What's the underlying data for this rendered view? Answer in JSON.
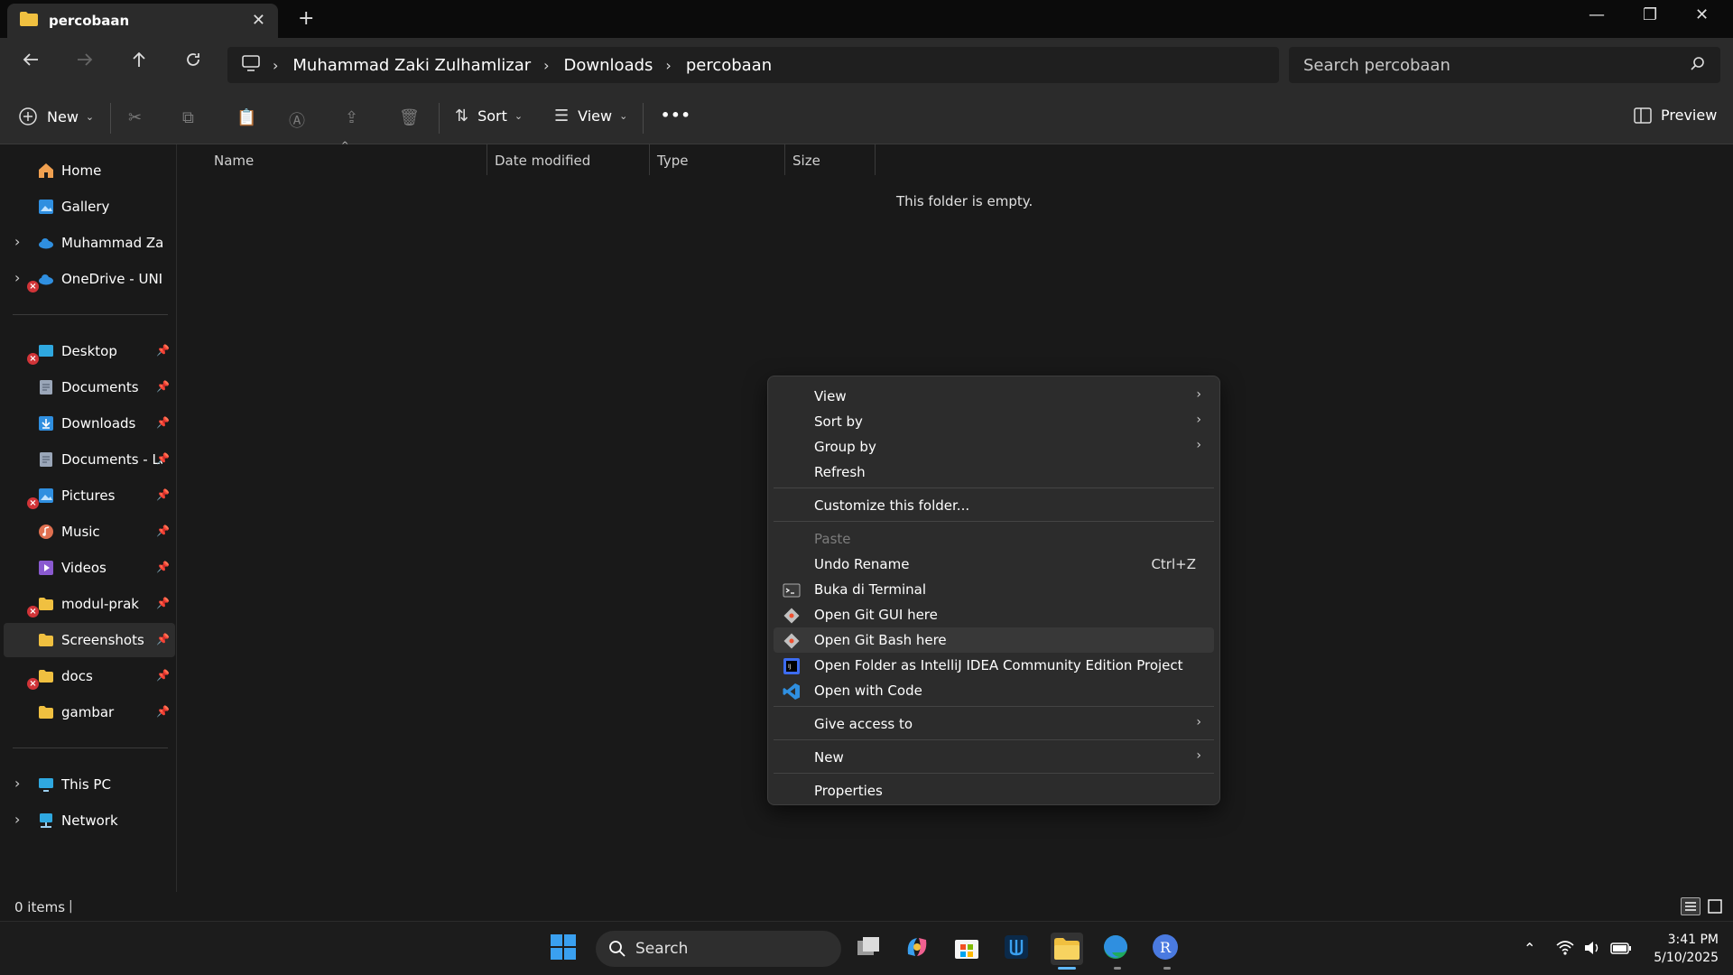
{
  "tab": {
    "title": "percobaan",
    "close": "✕",
    "new": "+"
  },
  "window": {
    "minimize": "—",
    "maximize": "❐",
    "close": "✕"
  },
  "nav": {
    "breadcrumb": [
      "Muhammad Zaki Zulhamlizar",
      "Downloads",
      "percobaan"
    ],
    "search_placeholder": "Search percobaan"
  },
  "commandbar": {
    "new_label": "New",
    "sort_label": "Sort",
    "view_label": "View",
    "more_label": "•••",
    "preview_label": "Preview"
  },
  "sidebar": {
    "top": [
      {
        "label": "Home",
        "icon": "home-icon",
        "color": "#f0a050"
      },
      {
        "label": "Gallery",
        "icon": "gallery-icon",
        "color": "#2f8fe0"
      },
      {
        "label": "Muhammad Zaki -",
        "icon": "onedrive-icon",
        "color": "#2f8fe0"
      },
      {
        "label": "OneDrive - UNIVER",
        "icon": "onedrive-icon",
        "color": "#2f8fe0"
      }
    ],
    "pinned": [
      {
        "label": "Desktop",
        "icon": "desktop-icon",
        "color": "#2fa8e0",
        "error": true
      },
      {
        "label": "Documents",
        "icon": "documents-icon",
        "color": "#9aa6b8",
        "error": false
      },
      {
        "label": "Downloads",
        "icon": "downloads-icon",
        "color": "#2f8fe0",
        "error": false
      },
      {
        "label": "Documents - Lap",
        "icon": "documents-icon",
        "color": "#9aa6b8",
        "error": false
      },
      {
        "label": "Pictures",
        "icon": "pictures-icon",
        "color": "#2f8fe0",
        "error": true
      },
      {
        "label": "Music",
        "icon": "music-icon",
        "color": "#e07050",
        "error": false
      },
      {
        "label": "Videos",
        "icon": "videos-icon",
        "color": "#8a5ad0",
        "error": false
      },
      {
        "label": "modul-prak",
        "icon": "folder-icon",
        "color": "#f0c040",
        "error": true
      },
      {
        "label": "Screenshots",
        "icon": "folder-icon",
        "color": "#f0c040",
        "error": false
      },
      {
        "label": "docs",
        "icon": "folder-icon",
        "color": "#f0c040",
        "error": true
      },
      {
        "label": "gambar",
        "icon": "folder-icon",
        "color": "#f0c040",
        "error": false
      }
    ],
    "bottom": [
      {
        "label": "This PC",
        "icon": "this-pc-icon",
        "color": "#2fa8e0"
      },
      {
        "label": "Network",
        "icon": "network-icon",
        "color": "#2fa8e0"
      }
    ]
  },
  "columns": {
    "name": "Name",
    "date": "Date modified",
    "type": "Type",
    "size": "Size"
  },
  "empty_message": "This folder is empty.",
  "context_menu": {
    "view": "View",
    "sort_by": "Sort by",
    "group_by": "Group by",
    "refresh": "Refresh",
    "customize": "Customize this folder...",
    "paste": "Paste",
    "undo_rename": "Undo Rename",
    "undo_shortcut": "Ctrl+Z",
    "terminal": "Buka di Terminal",
    "git_gui": "Open Git GUI here",
    "git_bash": "Open Git Bash here",
    "intellij": "Open Folder as IntelliJ IDEA Community Edition Project",
    "vscode": "Open with Code",
    "give_access": "Give access to",
    "new": "New",
    "properties": "Properties"
  },
  "status": {
    "items": "0 items"
  },
  "taskbar": {
    "search_label": "Search",
    "time": "3:41 PM",
    "date": "5/10/2025"
  }
}
